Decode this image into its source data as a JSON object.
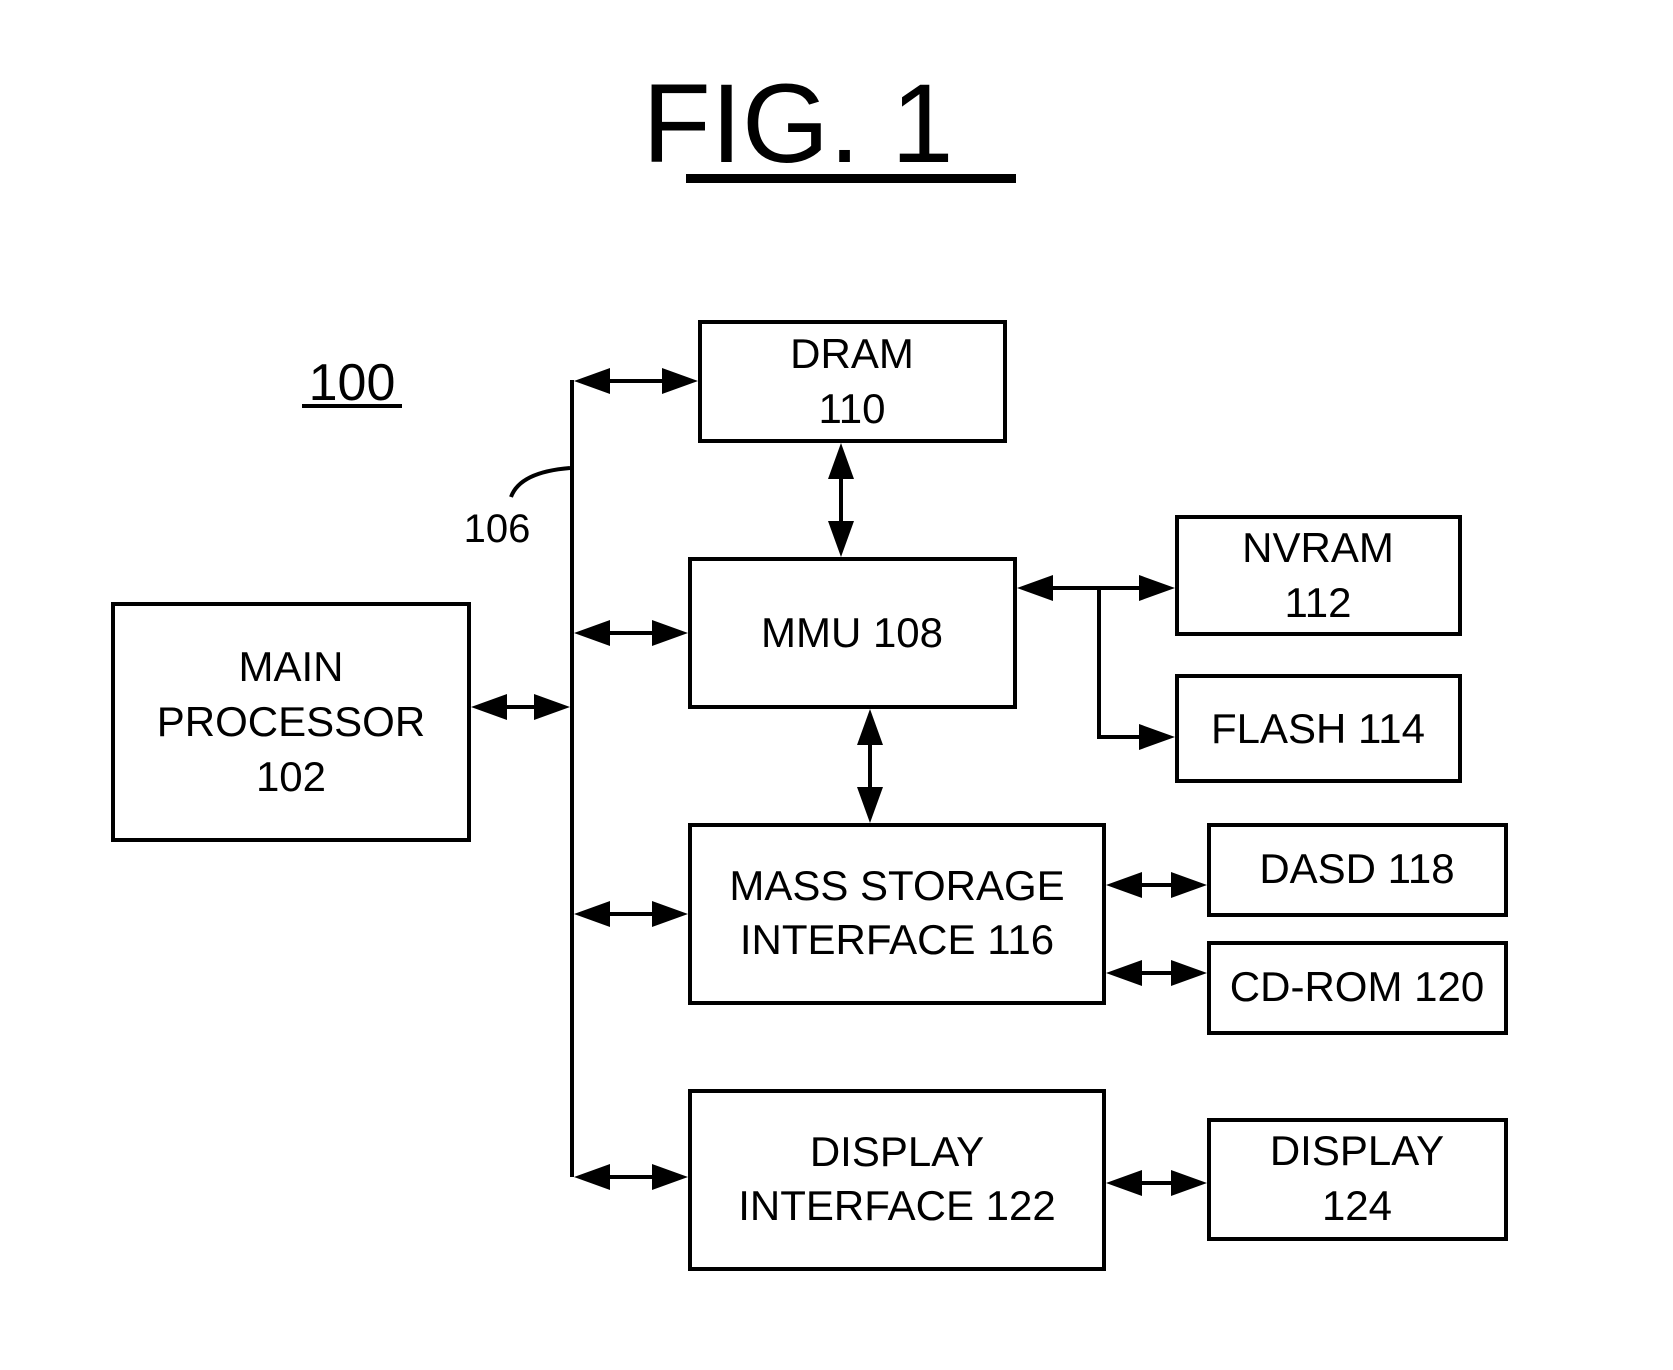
{
  "figure": {
    "title": "FIG. 1",
    "system_ref": "100",
    "bus_ref": "106"
  },
  "blocks": {
    "main_processor": {
      "lines": [
        "MAIN",
        "PROCESSOR",
        "102"
      ]
    },
    "dram": {
      "lines": [
        "DRAM",
        "110"
      ]
    },
    "mmu": {
      "lines": [
        "MMU 108"
      ]
    },
    "nvram": {
      "lines": [
        "NVRAM",
        "112"
      ]
    },
    "flash": {
      "lines": [
        "FLASH 114"
      ]
    },
    "mass_storage_interface": {
      "lines": [
        "MASS STORAGE",
        "INTERFACE 116"
      ]
    },
    "dasd": {
      "lines": [
        "DASD 118"
      ]
    },
    "cdrom": {
      "lines": [
        "CD-ROM 120"
      ]
    },
    "display_interface": {
      "lines": [
        "DISPLAY",
        "INTERFACE 122"
      ]
    },
    "display": {
      "lines": [
        "DISPLAY",
        "124"
      ]
    }
  },
  "connections": [
    {
      "from": "main_processor",
      "to": "bus_106",
      "type": "bidirectional"
    },
    {
      "from": "bus_106",
      "to": "dram",
      "type": "bidirectional"
    },
    {
      "from": "bus_106",
      "to": "mmu",
      "type": "bidirectional"
    },
    {
      "from": "bus_106",
      "to": "mass_storage_interface",
      "type": "bidirectional"
    },
    {
      "from": "bus_106",
      "to": "display_interface",
      "type": "bidirectional"
    },
    {
      "from": "dram",
      "to": "mmu",
      "type": "bidirectional"
    },
    {
      "from": "mmu",
      "to": "mass_storage_interface",
      "type": "bidirectional"
    },
    {
      "from": "mmu",
      "to": "nvram",
      "type": "bidirectional"
    },
    {
      "from": "mmu",
      "to": "flash",
      "type": "unidirectional"
    },
    {
      "from": "mass_storage_interface",
      "to": "dasd",
      "type": "bidirectional"
    },
    {
      "from": "mass_storage_interface",
      "to": "cdrom",
      "type": "bidirectional"
    },
    {
      "from": "display_interface",
      "to": "display",
      "type": "bidirectional"
    }
  ]
}
